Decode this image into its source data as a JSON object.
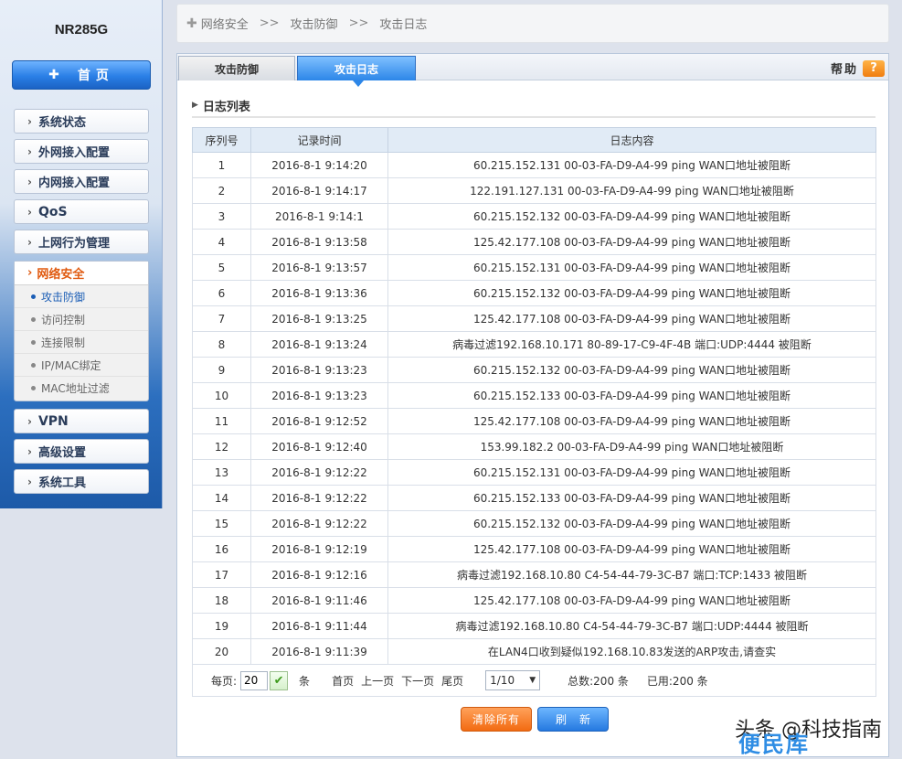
{
  "sidebar": {
    "model": "NR285G",
    "home_label": "首页",
    "home_icon": "plus-icon",
    "items": [
      {
        "label": "系统状态",
        "top": 0
      },
      {
        "label": "外网接入配置"
      },
      {
        "label": "内网接入配置"
      },
      {
        "label": "QoS"
      },
      {
        "label": "上网行为管理"
      }
    ],
    "security": {
      "label": "网络安全",
      "sub_items": [
        "攻击防御",
        "访问控制",
        "连接限制",
        "IP/MAC绑定",
        "MAC地址过滤"
      ]
    },
    "items_after": [
      "VPN",
      "高级设置",
      "系统工具"
    ]
  },
  "breadcrumb": {
    "parts": [
      "网络安全",
      "攻击防御",
      "攻击日志"
    ],
    "separator": ">>"
  },
  "tabs": {
    "defense": "攻击防御",
    "log": "攻击日志",
    "help": "帮助",
    "help_icon_char": "?"
  },
  "section": {
    "title": "日志列表"
  },
  "table": {
    "headers": [
      "序列号",
      "记录时间",
      "日志内容"
    ],
    "rows": [
      [
        "1",
        "2016-8-1 9:14:20",
        "60.215.152.131 00-03-FA-D9-A4-99 ping WAN口地址被阻断"
      ],
      [
        "2",
        "2016-8-1 9:14:17",
        "122.191.127.131 00-03-FA-D9-A4-99 ping WAN口地址被阻断"
      ],
      [
        "3",
        "2016-8-1 9:14:1",
        "60.215.152.132 00-03-FA-D9-A4-99 ping WAN口地址被阻断"
      ],
      [
        "4",
        "2016-8-1 9:13:58",
        "125.42.177.108 00-03-FA-D9-A4-99 ping WAN口地址被阻断"
      ],
      [
        "5",
        "2016-8-1 9:13:57",
        "60.215.152.131 00-03-FA-D9-A4-99 ping WAN口地址被阻断"
      ],
      [
        "6",
        "2016-8-1 9:13:36",
        "60.215.152.132 00-03-FA-D9-A4-99 ping WAN口地址被阻断"
      ],
      [
        "7",
        "2016-8-1 9:13:25",
        "125.42.177.108 00-03-FA-D9-A4-99 ping WAN口地址被阻断"
      ],
      [
        "8",
        "2016-8-1 9:13:24",
        "病毒过滤192.168.10.171 80-89-17-C9-4F-4B 端口:UDP:4444 被阻断"
      ],
      [
        "9",
        "2016-8-1 9:13:23",
        "60.215.152.132 00-03-FA-D9-A4-99 ping WAN口地址被阻断"
      ],
      [
        "10",
        "2016-8-1 9:13:23",
        "60.215.152.133 00-03-FA-D9-A4-99 ping WAN口地址被阻断"
      ],
      [
        "11",
        "2016-8-1 9:12:52",
        "125.42.177.108 00-03-FA-D9-A4-99 ping WAN口地址被阻断"
      ],
      [
        "12",
        "2016-8-1 9:12:40",
        "153.99.182.2 00-03-FA-D9-A4-99 ping WAN口地址被阻断"
      ],
      [
        "13",
        "2016-8-1 9:12:22",
        "60.215.152.131 00-03-FA-D9-A4-99 ping WAN口地址被阻断"
      ],
      [
        "14",
        "2016-8-1 9:12:22",
        "60.215.152.133 00-03-FA-D9-A4-99 ping WAN口地址被阻断"
      ],
      [
        "15",
        "2016-8-1 9:12:22",
        "60.215.152.132 00-03-FA-D9-A4-99 ping WAN口地址被阻断"
      ],
      [
        "16",
        "2016-8-1 9:12:19",
        "125.42.177.108 00-03-FA-D9-A4-99 ping WAN口地址被阻断"
      ],
      [
        "17",
        "2016-8-1 9:12:16",
        "病毒过滤192.168.10.80 C4-54-44-79-3C-B7 端口:TCP:1433 被阻断"
      ],
      [
        "18",
        "2016-8-1 9:11:46",
        "125.42.177.108 00-03-FA-D9-A4-99 ping WAN口地址被阻断"
      ],
      [
        "19",
        "2016-8-1 9:11:44",
        "病毒过滤192.168.10.80 C4-54-44-79-3C-B7 端口:UDP:4444 被阻断"
      ],
      [
        "20",
        "2016-8-1 9:11:39",
        "在LAN4口收到疑似192.168.10.83发送的ARP攻击,请查实"
      ]
    ]
  },
  "pager": {
    "per_page_label": "每页:",
    "per_page_value": "20",
    "unit": "条",
    "first": "首页",
    "prev": "上一页",
    "next": "下一页",
    "last": "尾页",
    "page_value": "1/10",
    "total": "总数:200 条",
    "used": "已用:200 条"
  },
  "buttons": {
    "clear": "清除所有",
    "refresh": "刷新"
  },
  "watermark": {
    "text": "头条 @科技指南",
    "logo": "便民库"
  },
  "colors": {
    "accent_blue": "#2c86e8",
    "accent_orange": "#f26b12",
    "active_nav": "#e05a10"
  }
}
